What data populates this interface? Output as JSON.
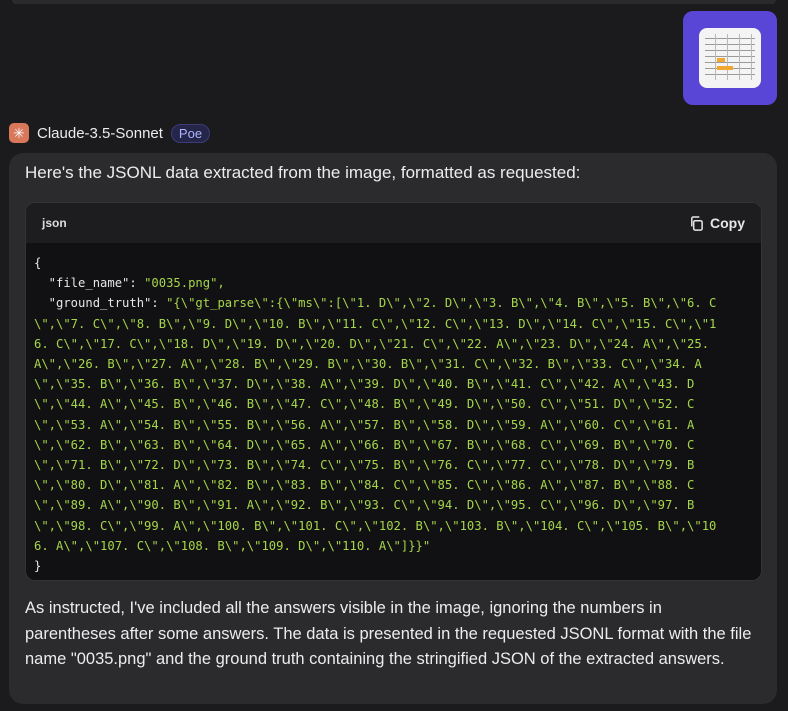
{
  "bot": {
    "name": "Claude-3.5-Sonnet",
    "badge": "Poe",
    "avatar_glyph": "✳"
  },
  "message": {
    "intro": "Here's the JSONL data extracted from the image, formatted as requested:",
    "code": {
      "language": "json",
      "copy_label": "Copy",
      "lines": [
        [
          "{",
          ""
        ],
        [
          "  \"file_name\": ",
          "\"0035.png\","
        ],
        [
          "  \"ground_truth\": ",
          "\"{\\\"gt_parse\\\":{\\\"ms\\\":[\\\"1. D\\\",\\\"2. D\\\",\\\"3. B\\\",\\\"4. B\\\",\\\"5. B\\\",\\\"6. C"
        ],
        [
          "",
          "\\\",\\\"7. C\\\",\\\"8. B\\\",\\\"9. D\\\",\\\"10. B\\\",\\\"11. C\\\",\\\"12. C\\\",\\\"13. D\\\",\\\"14. C\\\",\\\"15. C\\\",\\\"1"
        ],
        [
          "",
          "6. C\\\",\\\"17. C\\\",\\\"18. D\\\",\\\"19. D\\\",\\\"20. D\\\",\\\"21. C\\\",\\\"22. A\\\",\\\"23. D\\\",\\\"24. A\\\",\\\"25."
        ],
        [
          "",
          "A\\\",\\\"26. B\\\",\\\"27. A\\\",\\\"28. B\\\",\\\"29. B\\\",\\\"30. B\\\",\\\"31. C\\\",\\\"32. B\\\",\\\"33. C\\\",\\\"34. A"
        ],
        [
          "",
          "\\\",\\\"35. B\\\",\\\"36. B\\\",\\\"37. D\\\",\\\"38. A\\\",\\\"39. D\\\",\\\"40. B\\\",\\\"41. C\\\",\\\"42. A\\\",\\\"43. D"
        ],
        [
          "",
          "\\\",\\\"44. A\\\",\\\"45. B\\\",\\\"46. B\\\",\\\"47. C\\\",\\\"48. B\\\",\\\"49. D\\\",\\\"50. C\\\",\\\"51. D\\\",\\\"52. C"
        ],
        [
          "",
          "\\\",\\\"53. A\\\",\\\"54. B\\\",\\\"55. B\\\",\\\"56. A\\\",\\\"57. B\\\",\\\"58. D\\\",\\\"59. A\\\",\\\"60. C\\\",\\\"61. A"
        ],
        [
          "",
          "\\\",\\\"62. B\\\",\\\"63. B\\\",\\\"64. D\\\",\\\"65. A\\\",\\\"66. B\\\",\\\"67. B\\\",\\\"68. C\\\",\\\"69. B\\\",\\\"70. C"
        ],
        [
          "",
          "\\\",\\\"71. B\\\",\\\"72. D\\\",\\\"73. B\\\",\\\"74. C\\\",\\\"75. B\\\",\\\"76. C\\\",\\\"77. C\\\",\\\"78. D\\\",\\\"79. B"
        ],
        [
          "",
          "\\\",\\\"80. D\\\",\\\"81. A\\\",\\\"82. B\\\",\\\"83. B\\\",\\\"84. C\\\",\\\"85. C\\\",\\\"86. A\\\",\\\"87. B\\\",\\\"88. C"
        ],
        [
          "",
          "\\\",\\\"89. A\\\",\\\"90. B\\\",\\\"91. A\\\",\\\"92. B\\\",\\\"93. C\\\",\\\"94. D\\\",\\\"95. C\\\",\\\"96. D\\\",\\\"97. B"
        ],
        [
          "",
          "\\\",\\\"98. C\\\",\\\"99. A\\\",\\\"100. B\\\",\\\"101. C\\\",\\\"102. B\\\",\\\"103. B\\\",\\\"104. C\\\",\\\"105. B\\\",\\\"10"
        ],
        [
          "",
          "6. A\\\",\\\"107. C\\\",\\\"108. B\\\",\\\"109. D\\\",\\\"110. A\\\"]}}\""
        ],
        [
          "}",
          ""
        ]
      ]
    },
    "footer": "As instructed, I've included all the answers visible in the image, ignoring the numbers in parentheses after some answers. The data is presented in the requested JSONL format with the file name \"0035.png\" and the ground truth containing the stringified JSON of the extracted answers."
  },
  "colors": {
    "string": "#a6d64a",
    "thumb_bg": "#5946d6",
    "avatar": "#d9775a"
  }
}
